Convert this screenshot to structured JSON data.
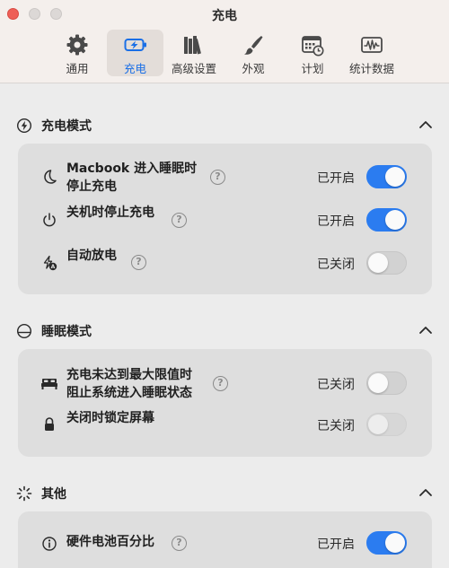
{
  "window": {
    "title": "充电"
  },
  "tabs": [
    {
      "label": "通用",
      "icon": "gear-icon"
    },
    {
      "label": "充电",
      "icon": "battery-charging-icon",
      "active": true
    },
    {
      "label": "高级设置",
      "icon": "books-icon"
    },
    {
      "label": "外观",
      "icon": "paintbrush-icon"
    },
    {
      "label": "计划",
      "icon": "calendar-clock-icon"
    },
    {
      "label": "统计数据",
      "icon": "waveform-chart-icon"
    }
  ],
  "sections": {
    "charge_mode": {
      "title": "充电模式",
      "icon": "bolt-circle-icon",
      "rows": [
        {
          "label": "Macbook 进入睡眠时\n停止充电",
          "status": "已开启",
          "enabled": true,
          "icon": "moon-icon"
        },
        {
          "label": "关机时停止充电",
          "status": "已开启",
          "enabled": true,
          "icon": "power-icon"
        },
        {
          "label": "自动放电",
          "status": "已关闭",
          "enabled": false,
          "icon": "auto-discharge-icon"
        }
      ]
    },
    "sleep_mode": {
      "title": "睡眠模式",
      "icon": "sunset-icon",
      "rows": [
        {
          "label": "充电未达到最大限值时\n阻止系统进入睡眠状态",
          "status": "已关闭",
          "enabled": false,
          "icon": "bed-icon"
        },
        {
          "label": "关闭时锁定屏幕",
          "status": "已关闭",
          "enabled": false,
          "icon": "lock-icon"
        }
      ]
    },
    "other": {
      "title": "其他",
      "icon": "loading-spinner-icon",
      "rows": [
        {
          "label": "硬件电池百分比",
          "status": "已开启",
          "enabled": true,
          "icon": "info-circle-icon"
        }
      ]
    }
  },
  "colors": {
    "accent": "#2b7cf0",
    "close": "#ee5f57"
  }
}
